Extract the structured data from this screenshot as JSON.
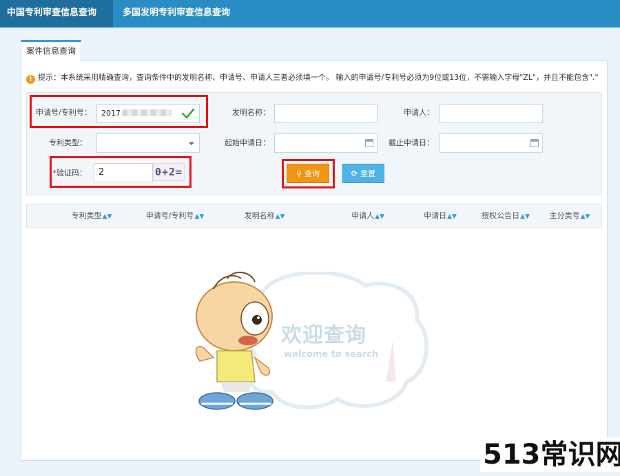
{
  "top_tabs": [
    {
      "label": "中国专利审查信息查询",
      "active": true
    },
    {
      "label": "多国发明专利审查信息查询",
      "active": false
    }
  ],
  "sub_tab": {
    "label": "案件信息查询"
  },
  "tip": {
    "text": "提示：本系统采用精确查询，查询条件中的发明名称、申请号、申请人三者必须填一个。 输入的申请号/专利号必须为9位或13位，不需输入字母\"ZL\"，并且不能包含\".\""
  },
  "form": {
    "app_no_label": "申请号/专利号：",
    "app_no_value": "2017",
    "invention_name_label": "发明名称：",
    "invention_name_value": "",
    "applicant_label": "申请人：",
    "applicant_value": "",
    "patent_type_label": "专利类型：",
    "patent_type_value": "",
    "start_date_label": "起始申请日：",
    "start_date_value": "",
    "end_date_label": "截止申请日：",
    "end_date_value": "",
    "captcha_star": "*",
    "captcha_label": "验证码：",
    "captcha_value": "2",
    "captcha_image_text": "0+2=",
    "search_label": "查询",
    "reset_label": "重置"
  },
  "table": {
    "columns": [
      "专利类型",
      "申请号/专利号",
      "发明名称",
      "申请人",
      "申请日",
      "授权公告日",
      "主分类号"
    ]
  },
  "welcome": {
    "title": "欢迎查询",
    "subtitle": "welcome to search"
  },
  "watermark": "513常识网",
  "colors": {
    "top_bar": "#2a8cc4",
    "active_tab": "#1f6f9e",
    "search_button": "#f39414",
    "reset_button": "#4fb3e7",
    "highlight_box": "#e5161c",
    "check": "#33aa33"
  }
}
